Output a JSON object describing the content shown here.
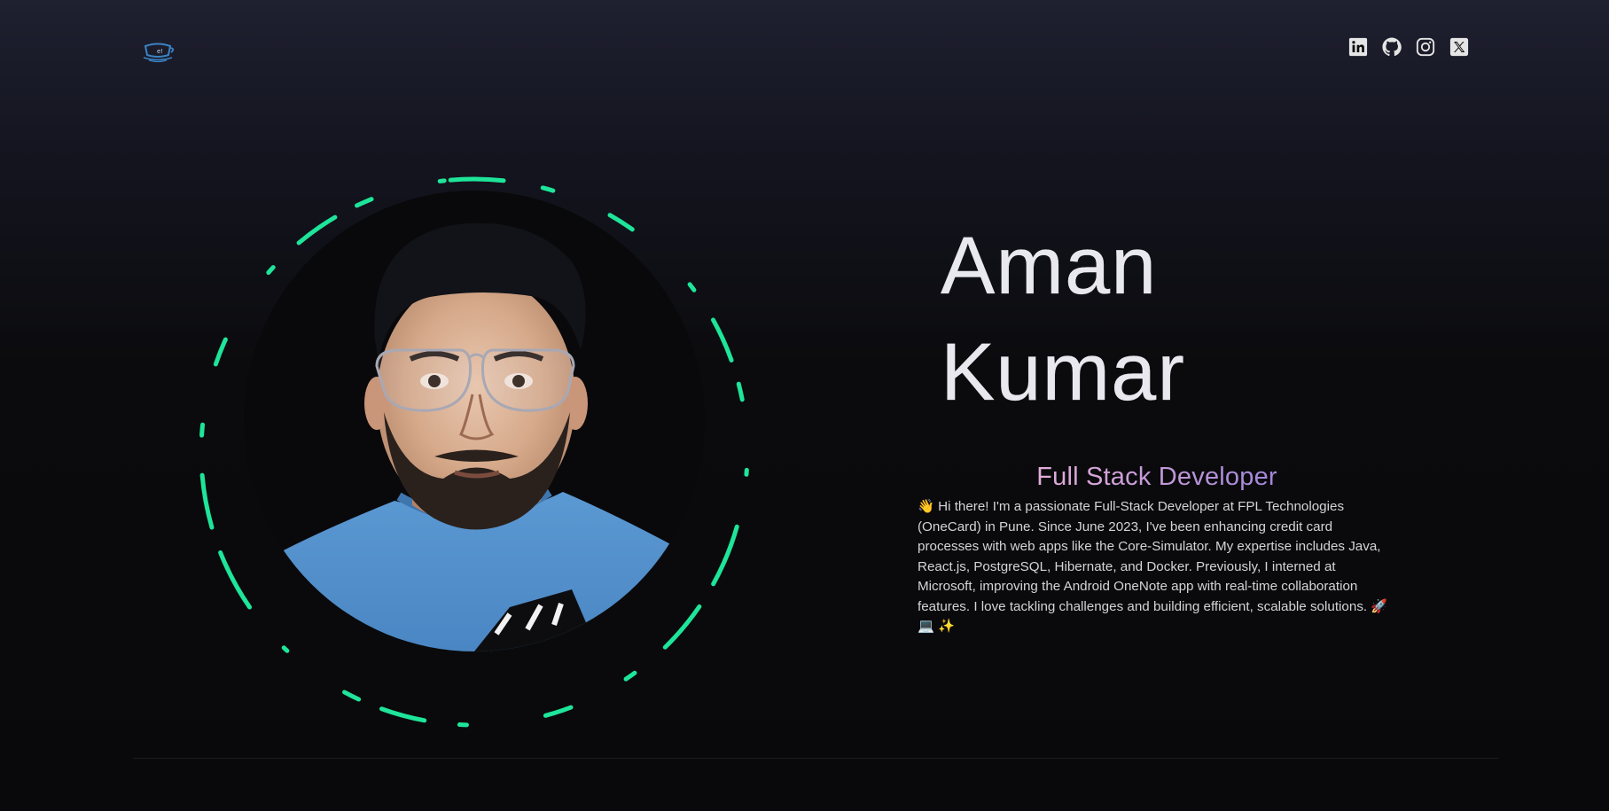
{
  "nav": {
    "logo_icon": "teacup-logo-icon",
    "socials": [
      {
        "name": "linkedin",
        "icon": "linkedin-icon"
      },
      {
        "name": "github",
        "icon": "github-icon"
      },
      {
        "name": "instagram",
        "icon": "instagram-icon"
      },
      {
        "name": "x",
        "icon": "x-icon"
      }
    ]
  },
  "hero": {
    "name": "Aman Kumar",
    "role": "Full Stack Developer",
    "bio": "👋 Hi there! I'm a passionate Full-Stack Developer at FPL Technologies (OneCard) in Pune. Since June 2023, I've been enhancing credit card processes with web apps like the Core-Simulator. My expertise includes Java, React.js, PostgreSQL, Hibernate, and Docker. Previously, I interned at Microsoft, improving the Android OneNote app with real-time collaboration features. I love tackling challenges and building efficient, scalable solutions. 🚀 💻 ✨"
  },
  "colors": {
    "ring": "#1ee59a",
    "background": "#09090b",
    "role_gradient_start": "#f5c1d8",
    "role_gradient_end": "#8f6fe0"
  }
}
